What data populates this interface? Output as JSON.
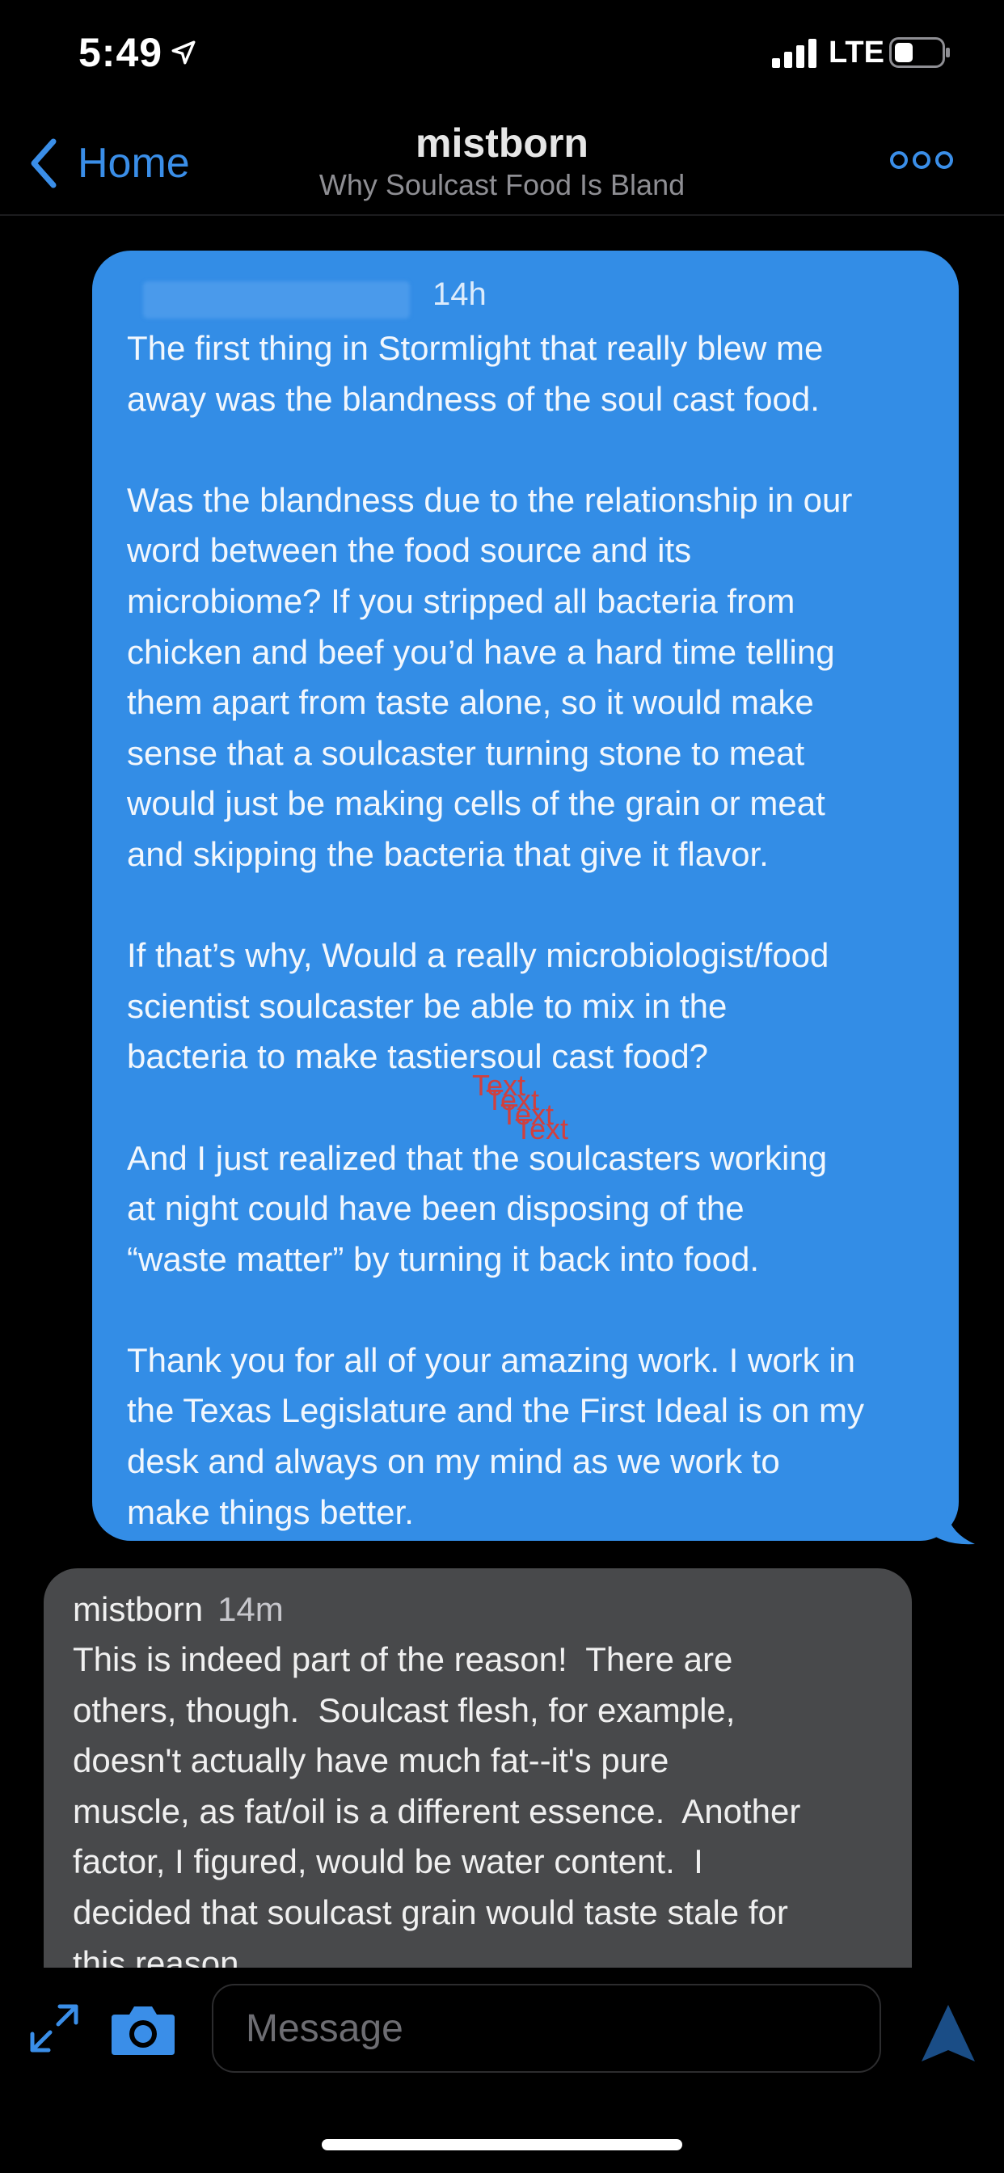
{
  "status_bar": {
    "time": "5:49",
    "network": "LTE",
    "icons": [
      "location-arrow-icon",
      "cellular-signal-icon",
      "battery-icon"
    ]
  },
  "nav": {
    "back_label": "Home",
    "title": "mistborn",
    "subtitle": "Why Soulcast Food Is Bland",
    "icons": [
      "chevron-left-icon",
      "more-options-icon"
    ]
  },
  "messages": {
    "outgoing": {
      "time": "14h",
      "stray_labels": [
        "Text",
        "Text",
        "Text",
        "Text"
      ],
      "text": "The first thing in Stormlight that really blew me\naway was the blandness of the soul cast food.\n\nWas the blandness due to the relationship in our\nword between the food source and its\nmicrobiome? If you stripped all bacteria from\nchicken and beef you’d have a hard time telling\nthem apart from taste alone, so it would make\nsense that a soulcaster turning stone to meat\nwould just be making cells of the grain or meat\nand skipping the bacteria that give it flavor.\n\nIf that’s why, Would a really microbiologist/food\nscientist soulcaster be able to mix in the\nbacteria to make tastiersoul cast food?\n\nAnd I just realized that the soulcasters working\nat night could have been disposing of the\n“waste matter” by turning it back into food.\n\nThank you for all of your amazing work. I work in\nthe Texas Legislature and the First Ideal is on my\ndesk and always on my mind as we work to\nmake things better."
    },
    "incoming": {
      "sender": "mistborn",
      "time": "14m",
      "text": "This is indeed part of the reason!  There are\nothers, though.  Soulcast flesh, for example,\ndoesn't actually have much fat--it's pure\nmuscle, as fat/oil is a different essence.  Another\nfactor, I figured, would be water content.  I\ndecided that soulcast grain would taste stale for\nthis reason."
    }
  },
  "composer": {
    "placeholder": "Message",
    "icons": [
      "expand-icon",
      "camera-icon",
      "send-icon"
    ]
  },
  "colors": {
    "accent": "#3a8ee8",
    "outgoing_bubble": "#338de6",
    "incoming_bubble": "#48494b",
    "background": "#000000",
    "stray_text": "#d0403f"
  }
}
